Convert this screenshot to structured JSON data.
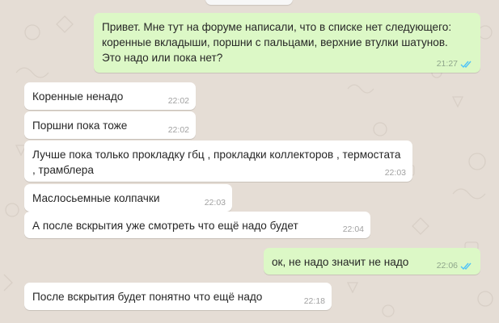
{
  "colors": {
    "wallpaper": "#e5ddd5",
    "incoming_bubble": "#ffffff",
    "outgoing_bubble": "#dcf8c6",
    "read_ticks": "#4fc3f7"
  },
  "messages": [
    {
      "direction": "outgoing",
      "text": "Привет. Мне тут на форуме написали, что в списке нет следующего:\nкоренные вкладыши, поршни с пальцами, верхние втулки шатунов.\nЭто надо или пока нет?",
      "time": "21:27",
      "status_icon": "double-check-read-icon"
    },
    {
      "direction": "incoming",
      "text": "Коренные ненадо",
      "time": "22:02"
    },
    {
      "direction": "incoming",
      "text": "Поршни пока тоже",
      "time": "22:02"
    },
    {
      "direction": "incoming",
      "text": "Лучше пока только прокладку гбц , прокладки коллекторов , термостата\n, трамблера",
      "time": "22:03"
    },
    {
      "direction": "incoming",
      "text": "Маслосьемные колпачки",
      "time": "22:03"
    },
    {
      "direction": "incoming",
      "text": "А после вскрытия уже смотреть что ещё надо будет",
      "time": "22:04"
    },
    {
      "direction": "outgoing",
      "text": "ок, не надо значит не надо",
      "time": "22:06",
      "status_icon": "double-check-read-icon"
    },
    {
      "direction": "incoming",
      "text": "После вскрытия будет понятно что ещё надо",
      "time": "22:18"
    }
  ]
}
